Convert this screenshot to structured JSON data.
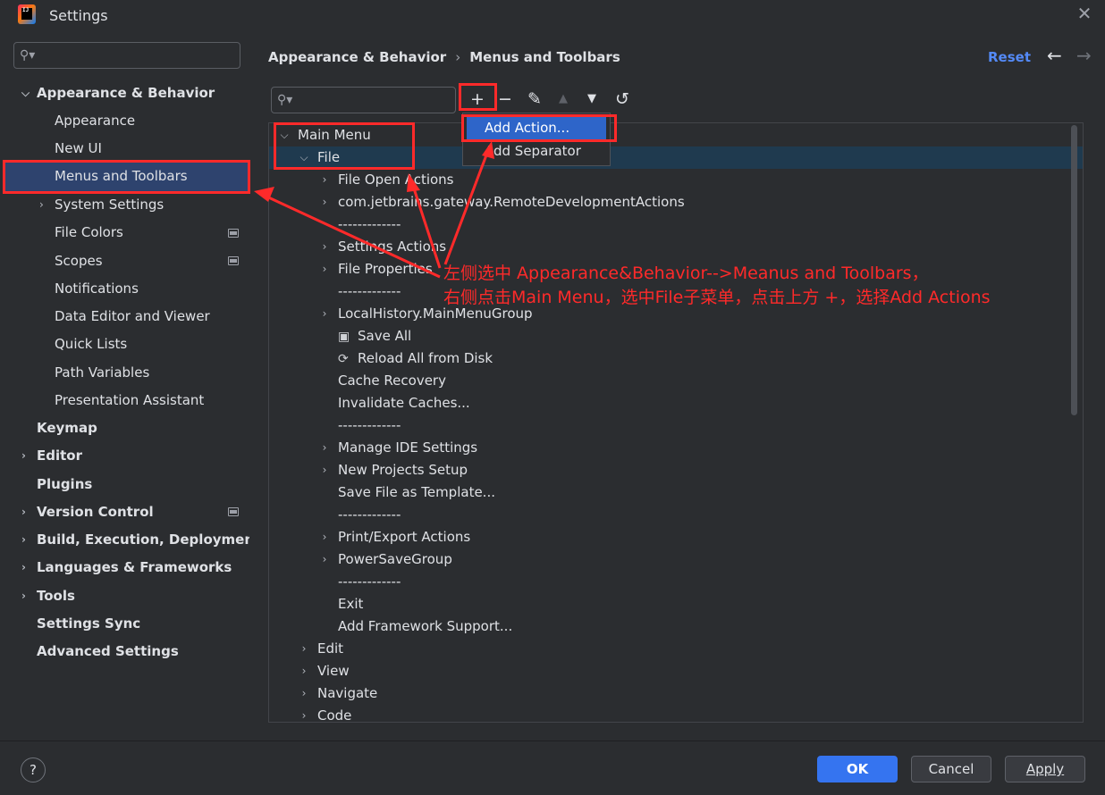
{
  "window": {
    "title": "Settings",
    "app_icon_text": "IJ"
  },
  "sidebar": {
    "search_placeholder": "",
    "items": [
      {
        "label": "Appearance & Behavior",
        "expanded": true
      },
      {
        "label": "Appearance"
      },
      {
        "label": "New UI"
      },
      {
        "label": "Menus and Toolbars",
        "selected": true
      },
      {
        "label": "System Settings"
      },
      {
        "label": "File Colors"
      },
      {
        "label": "Scopes"
      },
      {
        "label": "Notifications"
      },
      {
        "label": "Data Editor and Viewer"
      },
      {
        "label": "Quick Lists"
      },
      {
        "label": "Path Variables"
      },
      {
        "label": "Presentation Assistant"
      },
      {
        "label": "Keymap"
      },
      {
        "label": "Editor"
      },
      {
        "label": "Plugins"
      },
      {
        "label": "Version Control"
      },
      {
        "label": "Build, Execution, Deployment"
      },
      {
        "label": "Languages & Frameworks"
      },
      {
        "label": "Tools"
      },
      {
        "label": "Settings Sync"
      },
      {
        "label": "Advanced Settings"
      }
    ]
  },
  "content": {
    "breadcrumb": [
      "Appearance & Behavior",
      "Menus and Toolbars"
    ],
    "reset_label": "Reset",
    "toolbar_icons": [
      "add-icon",
      "remove-icon",
      "edit-icon",
      "move-up-icon",
      "move-down-icon",
      "restore-icon"
    ],
    "tree": [
      "Main Menu",
      "File",
      "File Open Actions",
      "com.jetbrains.gateway.RemoteDevelopmentActions",
      "-------------",
      "Settings Actions",
      "File Properties",
      "-------------",
      "LocalHistory.MainMenuGroup",
      "Save All",
      "Reload All from Disk",
      "Cache Recovery",
      "Invalidate Caches...",
      "-------------",
      "Manage IDE Settings",
      "New Projects Setup",
      "Save File as Template...",
      "-------------",
      "Print/Export Actions",
      "PowerSaveGroup",
      "-------------",
      "Exit",
      "Add Framework Support...",
      "Edit",
      "View",
      "Navigate",
      "Code"
    ],
    "popup": [
      "Add Action...",
      "Add Separator"
    ]
  },
  "annotation": {
    "line1": "左侧选中 Appearance&Behavior-->Meanus and Toolbars，",
    "line2": "右侧点击Main Menu，选中File子菜单，点击上方 +，选择Add Actions"
  },
  "footer": {
    "help": "?",
    "ok": "OK",
    "cancel": "Cancel",
    "apply": "Apply"
  },
  "colors": {
    "accent": "#3574f0",
    "selection": "#2e436e",
    "annotation": "#ff2a2a",
    "link": "#548af7"
  }
}
